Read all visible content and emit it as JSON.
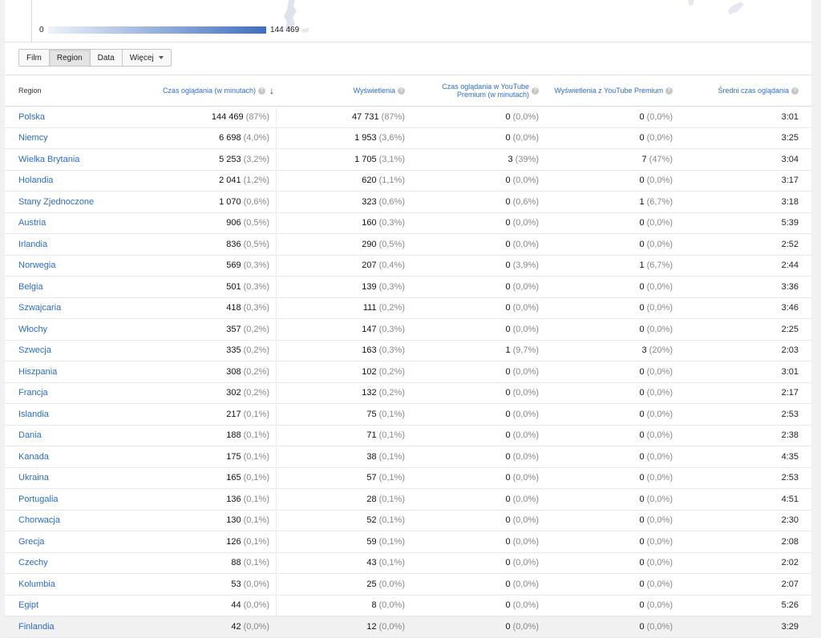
{
  "legend": {
    "min": "0",
    "max": "144 469"
  },
  "toolbar": {
    "buttons": [
      "Film",
      "Region",
      "Data",
      "Więcej"
    ],
    "active": "Region"
  },
  "table": {
    "headers": {
      "region": "Region",
      "watch_time": "Czas oglądania (w minutach)",
      "views": "Wyświetlenia",
      "premium_watch_time": "Czas oglądania w YouTube Premium (w minutach)",
      "premium_views": "Wyświetlenia z YouTube Premium",
      "avg_duration": "Średni czas oglądania"
    },
    "help_glyph": "?",
    "sort_glyph": "↓",
    "rows": [
      {
        "region": "Polska",
        "wt": "144 469",
        "wtp": "(87%)",
        "v": "47 731",
        "vp": "(87%)",
        "pwt": "0",
        "pwtp": "(0,0%)",
        "pv": "0",
        "pvp": "(0,0%)",
        "avg": "3:01"
      },
      {
        "region": "Niemcy",
        "wt": "6 698",
        "wtp": "(4,0%)",
        "v": "1 953",
        "vp": "(3,6%)",
        "pwt": "0",
        "pwtp": "(0,0%)",
        "pv": "0",
        "pvp": "(0,0%)",
        "avg": "3:25"
      },
      {
        "region": "Wielka Brytania",
        "wt": "5 253",
        "wtp": "(3,2%)",
        "v": "1 705",
        "vp": "(3,1%)",
        "pwt": "3",
        "pwtp": "(39%)",
        "pv": "7",
        "pvp": "(47%)",
        "avg": "3:04"
      },
      {
        "region": "Holandia",
        "wt": "2 041",
        "wtp": "(1,2%)",
        "v": "620",
        "vp": "(1,1%)",
        "pwt": "0",
        "pwtp": "(0,0%)",
        "pv": "0",
        "pvp": "(0,0%)",
        "avg": "3:17"
      },
      {
        "region": "Stany Zjednoczone",
        "wt": "1 070",
        "wtp": "(0,6%)",
        "v": "323",
        "vp": "(0,6%)",
        "pwt": "0",
        "pwtp": "(0,6%)",
        "pv": "1",
        "pvp": "(6,7%)",
        "avg": "3:18"
      },
      {
        "region": "Austria",
        "wt": "906",
        "wtp": "(0,5%)",
        "v": "160",
        "vp": "(0,3%)",
        "pwt": "0",
        "pwtp": "(0,0%)",
        "pv": "0",
        "pvp": "(0,0%)",
        "avg": "5:39"
      },
      {
        "region": "Irlandia",
        "wt": "836",
        "wtp": "(0,5%)",
        "v": "290",
        "vp": "(0,5%)",
        "pwt": "0",
        "pwtp": "(0,0%)",
        "pv": "0",
        "pvp": "(0,0%)",
        "avg": "2:52"
      },
      {
        "region": "Norwegia",
        "wt": "569",
        "wtp": "(0,3%)",
        "v": "207",
        "vp": "(0,4%)",
        "pwt": "0",
        "pwtp": "(3,9%)",
        "pv": "1",
        "pvp": "(6,7%)",
        "avg": "2:44"
      },
      {
        "region": "Belgia",
        "wt": "501",
        "wtp": "(0,3%)",
        "v": "139",
        "vp": "(0,3%)",
        "pwt": "0",
        "pwtp": "(0,0%)",
        "pv": "0",
        "pvp": "(0,0%)",
        "avg": "3:36"
      },
      {
        "region": "Szwajcaria",
        "wt": "418",
        "wtp": "(0,3%)",
        "v": "111",
        "vp": "(0,2%)",
        "pwt": "0",
        "pwtp": "(0,0%)",
        "pv": "0",
        "pvp": "(0,0%)",
        "avg": "3:46"
      },
      {
        "region": "Włochy",
        "wt": "357",
        "wtp": "(0,2%)",
        "v": "147",
        "vp": "(0,3%)",
        "pwt": "0",
        "pwtp": "(0,0%)",
        "pv": "0",
        "pvp": "(0,0%)",
        "avg": "2:25"
      },
      {
        "region": "Szwecja",
        "wt": "335",
        "wtp": "(0,2%)",
        "v": "163",
        "vp": "(0,3%)",
        "pwt": "1",
        "pwtp": "(9,7%)",
        "pv": "3",
        "pvp": "(20%)",
        "avg": "2:03"
      },
      {
        "region": "Hiszpania",
        "wt": "308",
        "wtp": "(0,2%)",
        "v": "102",
        "vp": "(0,2%)",
        "pwt": "0",
        "pwtp": "(0,0%)",
        "pv": "0",
        "pvp": "(0,0%)",
        "avg": "3:01"
      },
      {
        "region": "Francja",
        "wt": "302",
        "wtp": "(0,2%)",
        "v": "132",
        "vp": "(0,2%)",
        "pwt": "0",
        "pwtp": "(0,0%)",
        "pv": "0",
        "pvp": "(0,0%)",
        "avg": "2:17"
      },
      {
        "region": "Islandia",
        "wt": "217",
        "wtp": "(0,1%)",
        "v": "75",
        "vp": "(0,1%)",
        "pwt": "0",
        "pwtp": "(0,0%)",
        "pv": "0",
        "pvp": "(0,0%)",
        "avg": "2:53"
      },
      {
        "region": "Dania",
        "wt": "188",
        "wtp": "(0,1%)",
        "v": "71",
        "vp": "(0,1%)",
        "pwt": "0",
        "pwtp": "(0,0%)",
        "pv": "0",
        "pvp": "(0,0%)",
        "avg": "2:38"
      },
      {
        "region": "Kanada",
        "wt": "175",
        "wtp": "(0,1%)",
        "v": "38",
        "vp": "(0,1%)",
        "pwt": "0",
        "pwtp": "(0,0%)",
        "pv": "0",
        "pvp": "(0,0%)",
        "avg": "4:35"
      },
      {
        "region": "Ukraina",
        "wt": "165",
        "wtp": "(0,1%)",
        "v": "57",
        "vp": "(0,1%)",
        "pwt": "0",
        "pwtp": "(0,0%)",
        "pv": "0",
        "pvp": "(0,0%)",
        "avg": "2:53"
      },
      {
        "region": "Portugalia",
        "wt": "136",
        "wtp": "(0,1%)",
        "v": "28",
        "vp": "(0,1%)",
        "pwt": "0",
        "pwtp": "(0,0%)",
        "pv": "0",
        "pvp": "(0,0%)",
        "avg": "4:51"
      },
      {
        "region": "Chorwacja",
        "wt": "130",
        "wtp": "(0,1%)",
        "v": "52",
        "vp": "(0,1%)",
        "pwt": "0",
        "pwtp": "(0,0%)",
        "pv": "0",
        "pvp": "(0,0%)",
        "avg": "2:30"
      },
      {
        "region": "Grecja",
        "wt": "126",
        "wtp": "(0,1%)",
        "v": "59",
        "vp": "(0,1%)",
        "pwt": "0",
        "pwtp": "(0,0%)",
        "pv": "0",
        "pvp": "(0,0%)",
        "avg": "2:08"
      },
      {
        "region": "Czechy",
        "wt": "88",
        "wtp": "(0,1%)",
        "v": "43",
        "vp": "(0,1%)",
        "pwt": "0",
        "pwtp": "(0,0%)",
        "pv": "0",
        "pvp": "(0,0%)",
        "avg": "2:02"
      },
      {
        "region": "Kolumbia",
        "wt": "53",
        "wtp": "(0,0%)",
        "v": "25",
        "vp": "(0,0%)",
        "pwt": "0",
        "pwtp": "(0,0%)",
        "pv": "0",
        "pvp": "(0,0%)",
        "avg": "2:07"
      },
      {
        "region": "Egipt",
        "wt": "44",
        "wtp": "(0,0%)",
        "v": "8",
        "vp": "(0,0%)",
        "pwt": "0",
        "pwtp": "(0,0%)",
        "pv": "0",
        "pvp": "(0,0%)",
        "avg": "5:26"
      },
      {
        "region": "Finlandia",
        "wt": "42",
        "wtp": "(0,0%)",
        "v": "12",
        "vp": "(0,0%)",
        "pwt": "0",
        "pwtp": "(0,0%)",
        "pv": "0",
        "pvp": "(0,0%)",
        "avg": "3:29"
      }
    ]
  }
}
